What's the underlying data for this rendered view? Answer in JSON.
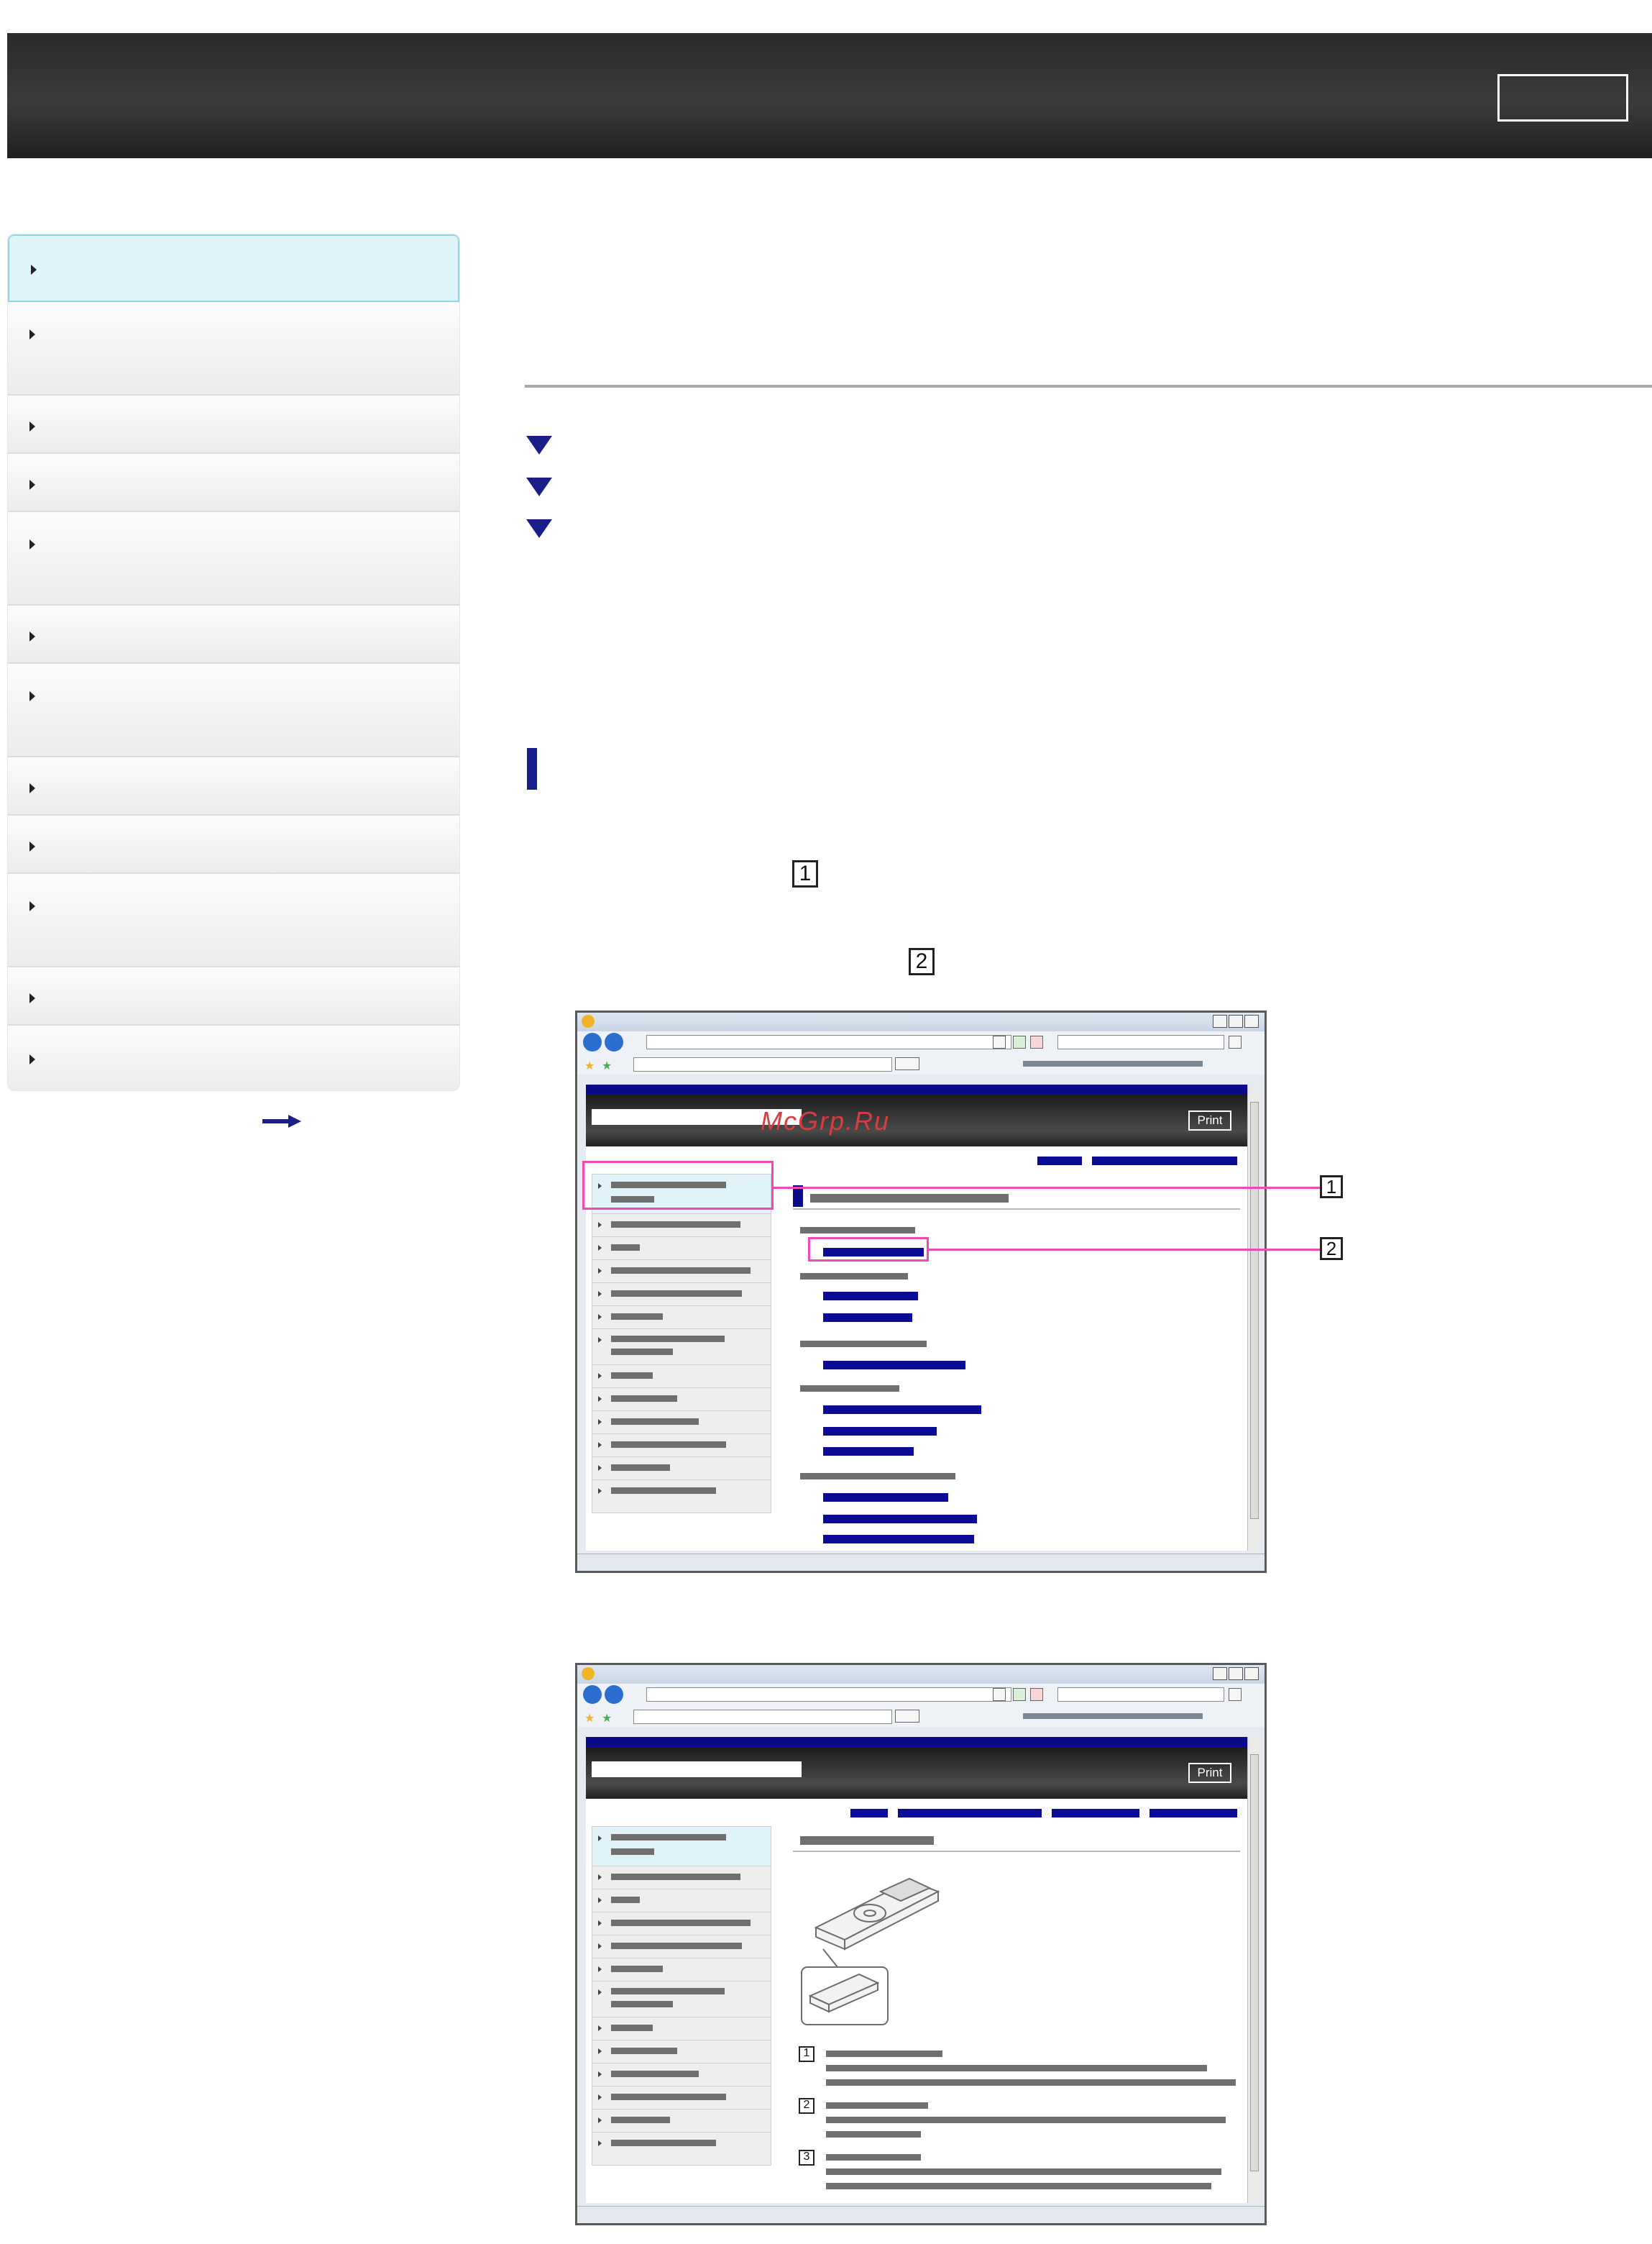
{
  "header": {
    "button_label": ""
  },
  "sidebar": {
    "items": [
      {
        "label": ""
      },
      {
        "label": ""
      },
      {
        "label": ""
      },
      {
        "label": ""
      },
      {
        "label": ""
      },
      {
        "label": ""
      },
      {
        "label": ""
      },
      {
        "label": ""
      },
      {
        "label": ""
      },
      {
        "label": ""
      },
      {
        "label": ""
      },
      {
        "label": ""
      }
    ],
    "arrow_icon": "right-arrow-icon"
  },
  "main": {
    "step_markers": [
      "1",
      "2"
    ]
  },
  "screenshot1": {
    "print_label": "Print",
    "callouts": [
      "1",
      "2"
    ],
    "watermark": "McGrp.Ru"
  },
  "screenshot2": {
    "print_label": "Print",
    "list_numbers": [
      "1",
      "2",
      "3"
    ]
  },
  "colors": {
    "accent": "#1a1e86",
    "highlight": "#f04bb4",
    "header_bg": "#2a2a2a"
  }
}
